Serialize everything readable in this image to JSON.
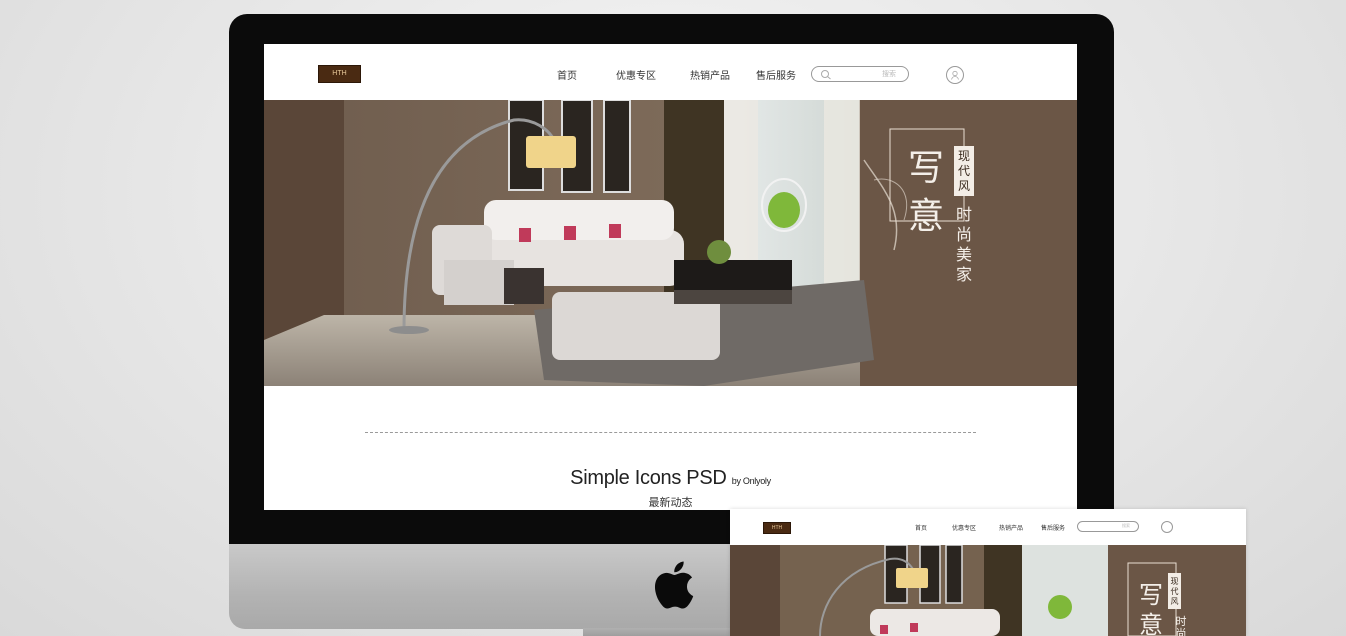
{
  "site": {
    "logo_text": "HTH",
    "nav_items": [
      "首页",
      "优惠专区",
      "热销产品",
      "售后服务"
    ],
    "search_placeholder": "搜索",
    "banner": {
      "badge": "现代风",
      "big_text_1": "写",
      "big_text_2": "意",
      "tagline": "时尚美家"
    },
    "section": {
      "title": "Simple Icons PSD",
      "byline": "by Onlyoly",
      "subtitle": "最新动态"
    }
  },
  "icons": [
    "apple-logo-icon",
    "search-icon",
    "user-icon"
  ],
  "colors": {
    "brand_brown": "#4a2a12",
    "banner_wall": "#6a5646",
    "bezel": "#0b0b0b"
  }
}
